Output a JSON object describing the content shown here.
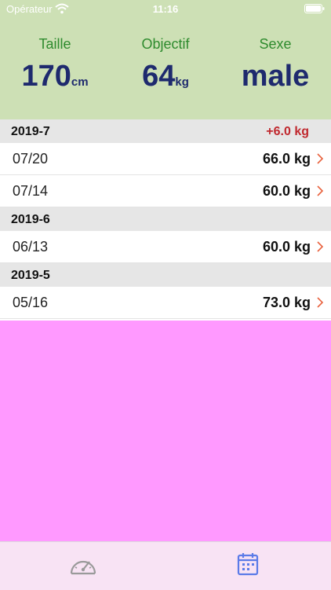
{
  "status": {
    "carrier": "Opérateur",
    "time": "11:16"
  },
  "header": {
    "height": {
      "label": "Taille",
      "value": "170",
      "unit": "cm"
    },
    "goal": {
      "label": "Objectif",
      "value": "64",
      "unit": "kg"
    },
    "sex": {
      "label": "Sexe",
      "value": "male"
    }
  },
  "sections": [
    {
      "month": "2019-7",
      "diff": "+6.0 kg",
      "rows": [
        {
          "date": "07/20",
          "weight": "66.0 kg"
        },
        {
          "date": "07/14",
          "weight": "60.0 kg"
        }
      ]
    },
    {
      "month": "2019-6",
      "rows": [
        {
          "date": "06/13",
          "weight": "60.0 kg"
        }
      ]
    },
    {
      "month": "2019-5",
      "rows": [
        {
          "date": "05/16",
          "weight": "73.0 kg"
        }
      ]
    }
  ],
  "tabs": [
    {
      "icon": "speedometer-icon",
      "active": false
    },
    {
      "icon": "calendar-icon",
      "active": true
    }
  ],
  "colors": {
    "header_bg": "#cde0b5",
    "label_green": "#2e8b2e",
    "value_navy": "#1e2a6e",
    "diff_red": "#c0282e",
    "chevron_orange": "#e8623e",
    "empty_bg": "#ff99ff",
    "tabbar_bg": "#f8e3f4",
    "tab_active": "#5b7be8",
    "tab_inactive": "#9a9a9a"
  }
}
